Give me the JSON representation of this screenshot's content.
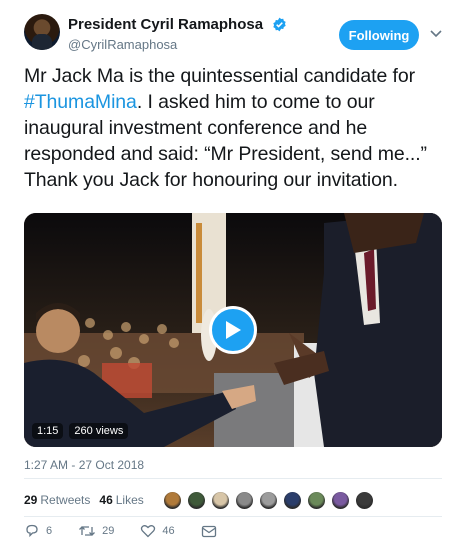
{
  "header": {
    "display_name": "President Cyril Ramaphosa",
    "handle": "@CyrilRamaphosa",
    "follow_label": "Following"
  },
  "tweet": {
    "text_before": "Mr Jack Ma is the quintessential candidate for ",
    "hashtag": "#ThumaMina",
    "text_after": ". I asked him to come to our inaugural investment conference and he responded and said: “Mr President, send me...” Thank you Jack for honouring our invitation."
  },
  "video": {
    "duration": "1:15",
    "views": "260 views"
  },
  "timestamp": "1:27 AM - 27 Oct 2018",
  "engagement": {
    "retweets_count": "29",
    "retweets_label": "Retweets",
    "likes_count": "46",
    "likes_label": "Likes",
    "liker_colors": [
      "#b07a3a",
      "#3f5a3a",
      "#d8c6a8",
      "#8a8a8a",
      "#9c9c9c",
      "#2b3e6b",
      "#6b8a5a",
      "#7a5aa0",
      "#3a3a3a"
    ]
  },
  "actions": {
    "reply_count": "6",
    "retweet_count": "29",
    "like_count": "46"
  },
  "colors": {
    "accent": "#1da1f2",
    "link": "#1b95e0",
    "muted": "#657786"
  }
}
